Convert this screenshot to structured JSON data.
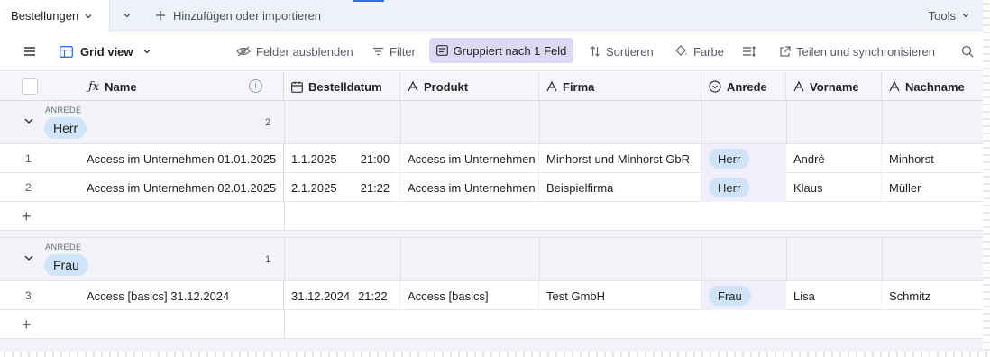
{
  "tabbar": {
    "active_tab": "Bestellungen",
    "add_import": "Hinzufügen oder importieren",
    "tools": "Tools"
  },
  "toolbar": {
    "view_name": "Grid view",
    "hide_fields": "Felder ausblenden",
    "filter": "Filter",
    "grouped": "Gruppiert nach 1 Feld",
    "sort": "Sortieren",
    "color": "Farbe",
    "share_sync": "Teilen und synchronisieren"
  },
  "columns": {
    "name": "Name",
    "bestelldatum": "Bestelldatum",
    "produkt": "Produkt",
    "firma": "Firma",
    "anrede": "Anrede",
    "vorname": "Vorname",
    "nachname": "Nachname"
  },
  "groups": [
    {
      "label": "ANREDE",
      "value": "Herr",
      "count": "2",
      "rows": [
        {
          "num": "1",
          "name": "Access im Unternehmen 01.01.2025",
          "date": "1.1.2025",
          "time": "21:00",
          "produkt": "Access im Unternehmen",
          "firma": "Minhorst und Minhorst GbR",
          "anrede": "Herr",
          "vorname": "André",
          "nachname": "Minhorst"
        },
        {
          "num": "2",
          "name": "Access im Unternehmen 02.01.2025",
          "date": "2.1.2025",
          "time": "21:22",
          "produkt": "Access im Unternehmen",
          "firma": "Beispielfirma",
          "anrede": "Herr",
          "vorname": "Klaus",
          "nachname": "Müller"
        }
      ]
    },
    {
      "label": "ANREDE",
      "value": "Frau",
      "count": "1",
      "rows": [
        {
          "num": "3",
          "name": "Access [basics] 31.12.2024",
          "date": "31.12.2024",
          "time": "21:22",
          "produkt": "Access [basics]",
          "firma": "Test GmbH",
          "anrede": "Frau",
          "vorname": "Lisa",
          "nachname": "Schmitz"
        }
      ]
    }
  ],
  "icons": {
    "table": "grid-table-icon",
    "formula": "formula-icon",
    "calendar": "calendar-icon",
    "text": "text-field-icon",
    "single_select": "single-select-icon"
  },
  "colors": {
    "grouped_bg": "#ddd9f5",
    "pill_bg": "#cfe4fa",
    "accent": "#3b6fd8"
  }
}
